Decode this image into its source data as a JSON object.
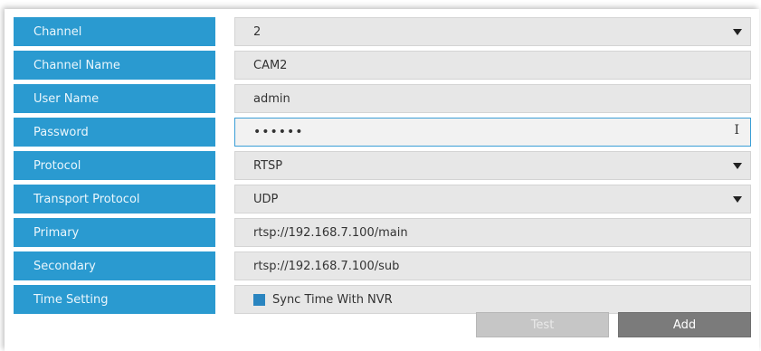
{
  "form": {
    "channel": {
      "label": "Channel",
      "value": "2"
    },
    "channel_name": {
      "label": "Channel Name",
      "value": "CAM2"
    },
    "user_name": {
      "label": "User Name",
      "value": "admin"
    },
    "password": {
      "label": "Password",
      "value": "••••••"
    },
    "protocol": {
      "label": "Protocol",
      "value": "RTSP"
    },
    "transport_protocol": {
      "label": "Transport Protocol",
      "value": "UDP"
    },
    "primary": {
      "label": "Primary",
      "value": "rtsp://192.168.7.100/main"
    },
    "secondary": {
      "label": "Secondary",
      "value": "rtsp://192.168.7.100/sub"
    },
    "time_setting": {
      "label": "Time Setting",
      "checkbox_label": "Sync Time With NVR",
      "checked": true
    }
  },
  "buttons": {
    "test_label": "Test",
    "add_label": "Add"
  },
  "colors": {
    "label_bg": "#2a9ad0",
    "field_bg": "#e7e7e7",
    "checkbox": "#2a85c0",
    "add_button": "#7b7b7b",
    "test_button": "#c6c6c6"
  },
  "icons": {
    "dropdown": "caret-down-icon",
    "text_cursor": "i-beam-cursor-icon"
  }
}
